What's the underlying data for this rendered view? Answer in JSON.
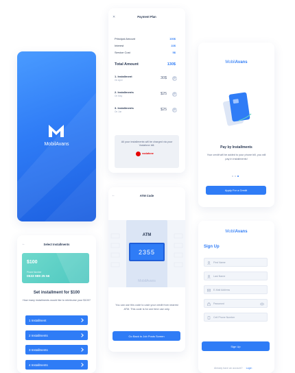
{
  "splash": {
    "brand": "MobilAvans"
  },
  "payment_plan": {
    "title": "Payment Plan",
    "rows": [
      {
        "label": "Principal Amount",
        "value": "100$"
      },
      {
        "label": "Interest",
        "value": "22$"
      },
      {
        "label": "Service Cost",
        "value": "5$"
      }
    ],
    "total_label": "Total Amount",
    "total_value": "130$",
    "installments": [
      {
        "name": "1. Installment",
        "date": "On Aprıl",
        "amount": "30$"
      },
      {
        "name": "2. Installments",
        "date": "On May",
        "amount": "$25"
      },
      {
        "name": "3. Installments",
        "date": "On Jun",
        "amount": "$25"
      }
    ],
    "notice": "All your installments will be charged via your Vodafone bill.",
    "carrier": "vodafone"
  },
  "onboarding": {
    "brand_prefix": "Mobil",
    "brand_suffix": "Avans",
    "heading": "Pay by Installments",
    "text": "Your credit will be added to your phone bill, you will pay in installments!",
    "button": "Apply For a Credit"
  },
  "atm_code": {
    "title": "ATM Code",
    "atm_label": "ATM",
    "code": "2355",
    "watermark": "MobilAvans",
    "info": "You can use this code to cash your credit from nearest ATM. This code is for one time use only.",
    "button": "Go Back to Job Posts Screen"
  },
  "signup": {
    "brand_prefix": "Mobil",
    "brand_suffix": "Avans",
    "heading": "Sign Up",
    "fields": [
      "First Name",
      "Last Name",
      "E-Mail Address",
      "Password",
      "Cell Phone Number"
    ],
    "button": "Sign Up",
    "footer_text": "Already have an account?",
    "footer_link": "Login"
  },
  "select_installments": {
    "title": "Select Installments",
    "card_amount": "$100",
    "card_caption": "Phone Number",
    "card_number": "0533 989 25 56",
    "heading": "Set installment for $100",
    "question": "How many installments would like to reimburse your $100?",
    "options": [
      "1 Installment",
      "2 Installments",
      "3 Installments",
      "4 Installments"
    ]
  },
  "colors": {
    "accent": "#2f7cf6",
    "card_teal": "#5fd3c7",
    "vodafone": "#e60000"
  }
}
